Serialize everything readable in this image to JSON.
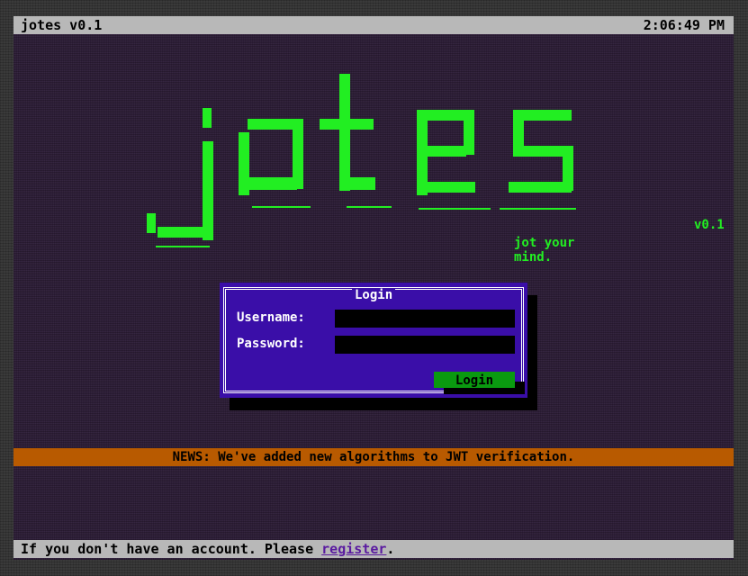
{
  "topbar": {
    "app_title": "jotes v0.1",
    "clock": "2:06:49 PM"
  },
  "logo": {
    "wordmark": "jotes",
    "version": "v0.1",
    "tagline": "jot your mind."
  },
  "login_dialog": {
    "title": "Login",
    "username_label": "Username:",
    "username_value": "",
    "password_label": "Password:",
    "password_value": "",
    "login_button": "Login"
  },
  "news": {
    "text": "NEWS: We've added new algorithms to JWT verification."
  },
  "bottombar": {
    "prefix": "If you don't have an account. Please ",
    "register_link": "register",
    "suffix": "."
  },
  "colors": {
    "accent_green": "#22ee22",
    "dialog_blue": "#3a0ea8",
    "news_orange": "#b85a00",
    "bar_gray": "#b8b8b8"
  }
}
